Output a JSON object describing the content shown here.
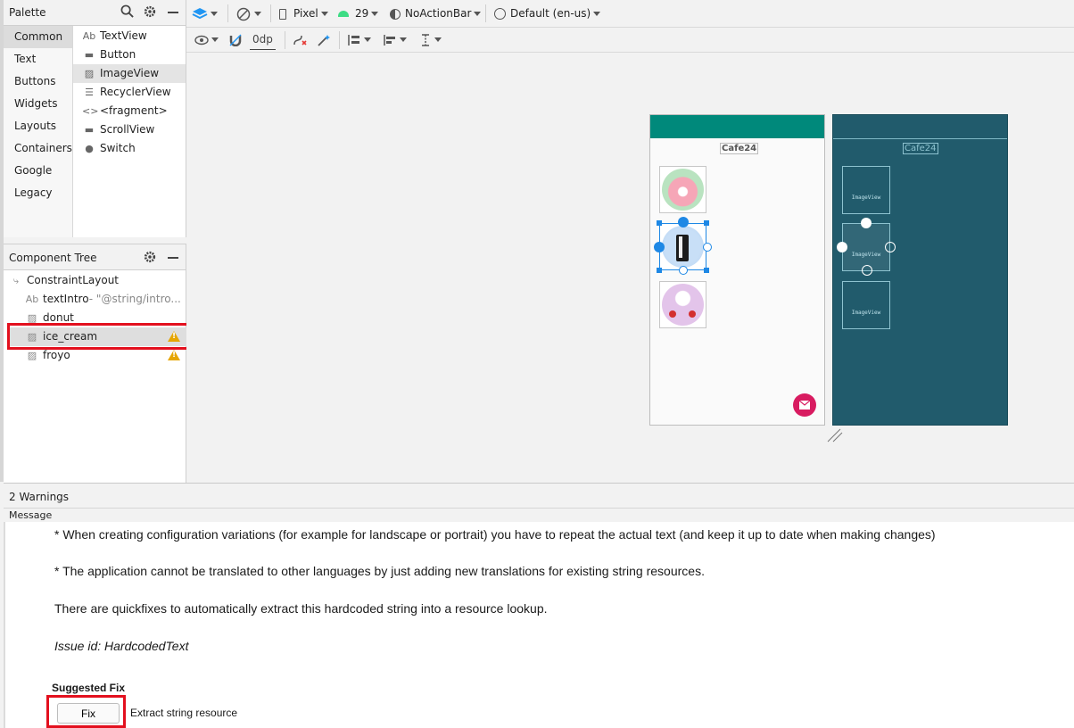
{
  "palette": {
    "title": "Palette",
    "categories": [
      "Common",
      "Text",
      "Buttons",
      "Widgets",
      "Layouts",
      "Containers",
      "Google",
      "Legacy"
    ],
    "components": [
      {
        "icon": "Ab",
        "label": "TextView"
      },
      {
        "icon": "▬",
        "label": "Button"
      },
      {
        "icon": "▨",
        "label": "ImageView"
      },
      {
        "icon": "☰",
        "label": "RecyclerView"
      },
      {
        "icon": "<>",
        "label": "<fragment>"
      },
      {
        "icon": "▬",
        "label": "ScrollView"
      },
      {
        "icon": "●",
        "label": "Switch"
      }
    ]
  },
  "tree": {
    "title": "Component Tree",
    "root": "ConstraintLayout",
    "nodes": [
      {
        "icon": "Ab",
        "label": "textIntro",
        "extra": "- \"@string/intro..."
      },
      {
        "icon": "▨",
        "label": "donut",
        "extra": ""
      },
      {
        "icon": "▨",
        "label": "ice_cream",
        "extra": ""
      },
      {
        "icon": "▨",
        "label": "froyo",
        "extra": ""
      }
    ]
  },
  "toolbar": {
    "device": "Pixel",
    "api": "29",
    "theme": "NoActionBar",
    "locale": "Default (en-us)",
    "margin": "0dp"
  },
  "canvas": {
    "title_light": "Cafe24",
    "title_blue": "Cafe24",
    "image_label": "ImageView",
    "colors": {
      "appbar": "#00897b",
      "blueprint": "#215b6c",
      "fab": "#d81b60",
      "selection": "#1e88e5"
    }
  },
  "bottom": {
    "warnings": "2 Warnings",
    "message_header": "Message",
    "p1": "* When creating configuration variations (for example for landscape or portrait) you have to repeat the actual text (and keep it up to date when making changes)",
    "p2": "* The application cannot be translated to other languages by just adding new translations for existing string resources.",
    "p3": "There are quickfixes to automatically extract this hardcoded string into a resource lookup.",
    "issue": "Issue id: HardcodedText",
    "suggested": "Suggested Fix",
    "fix_button": "Fix",
    "fix_desc": "Extract string resource"
  }
}
